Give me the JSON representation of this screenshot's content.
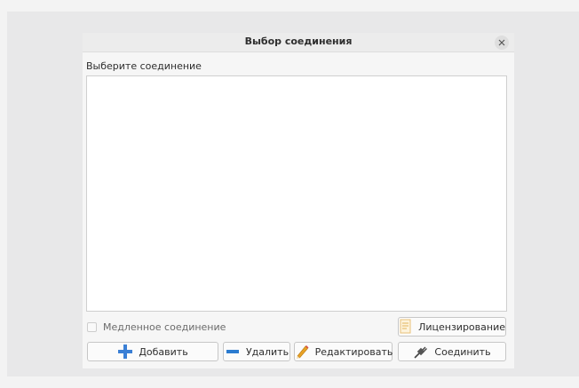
{
  "dialog": {
    "title": "Выбор соединения",
    "prompt": "Выберите соединение",
    "connections": [],
    "slow_connection": {
      "label": "Медленное соединение",
      "checked": false
    },
    "buttons": {
      "license": "Лицензирование",
      "add": "Добавить",
      "remove": "Удалить",
      "edit": "Редактировать",
      "connect": "Соединить"
    },
    "icons": {
      "close": "close-icon",
      "license": "license-doc-icon",
      "add": "plus-icon",
      "remove": "minus-icon",
      "edit": "pencil-icon",
      "connect": "plug-icon"
    },
    "colors": {
      "plus": "#3a7fd5",
      "minus": "#2b7bd0",
      "pencil": "#e8a226"
    }
  }
}
